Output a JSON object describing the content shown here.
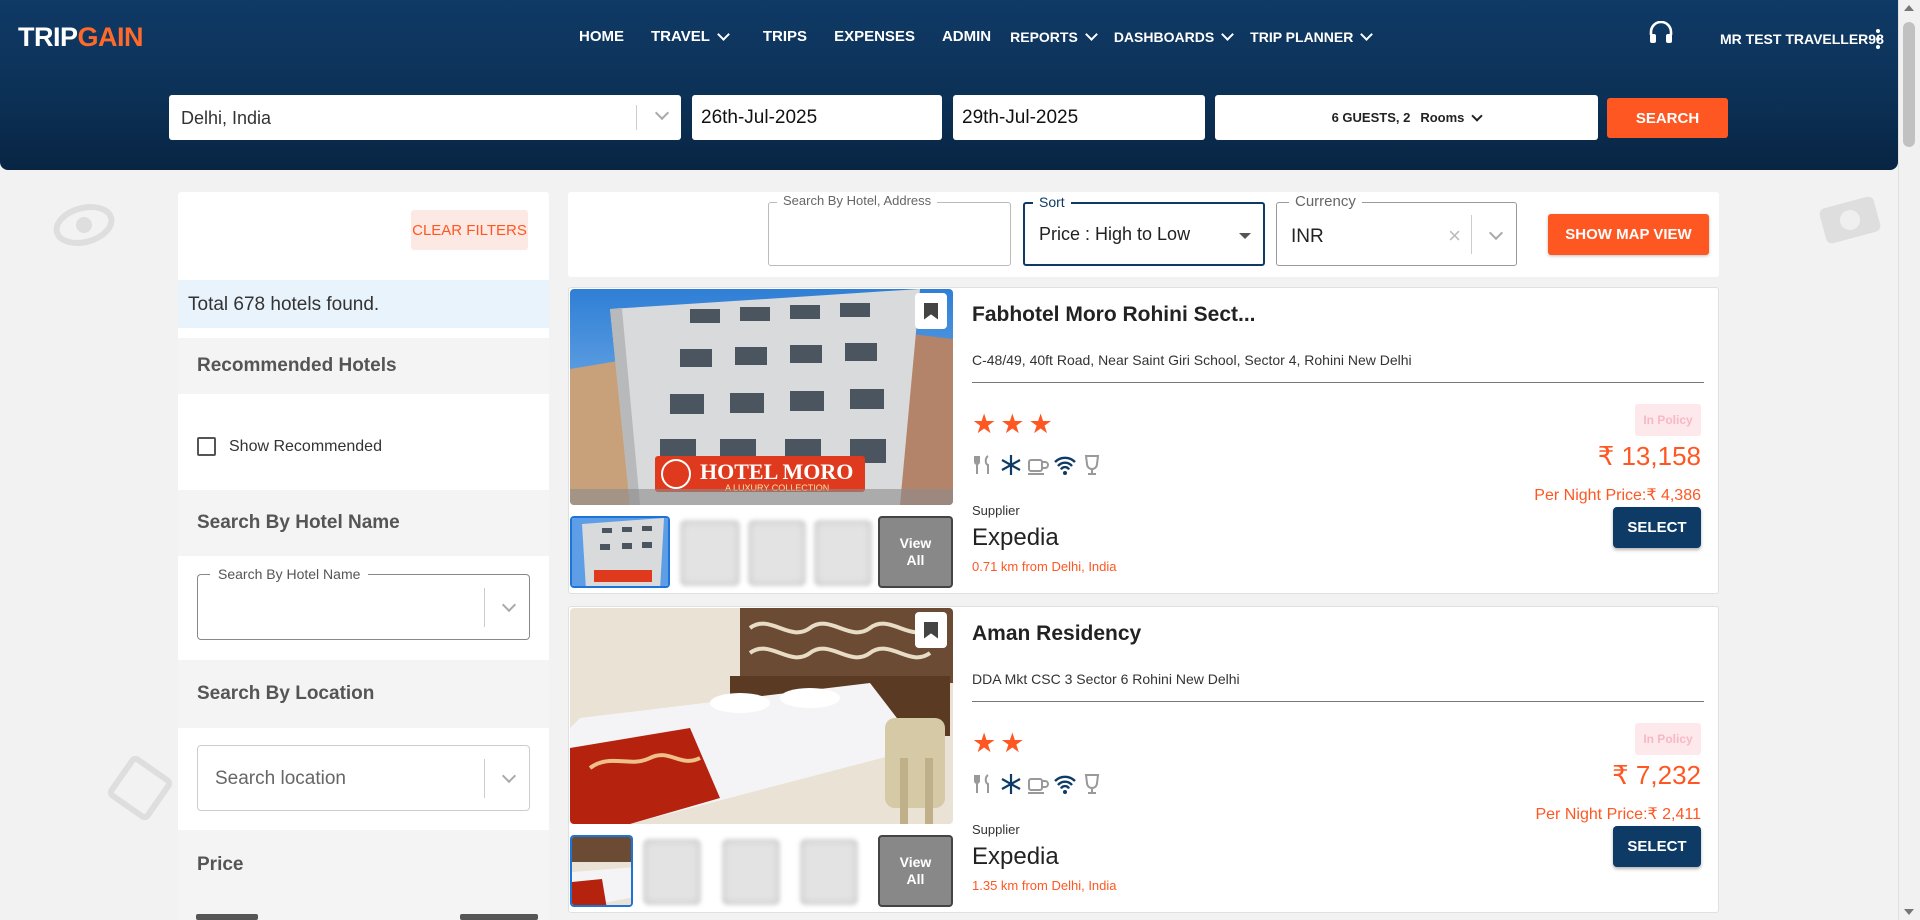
{
  "brand": {
    "logo_part1": "TRIP",
    "logo_part2": "GAIN"
  },
  "nav": {
    "items": [
      {
        "label": "HOME",
        "has_dropdown": false
      },
      {
        "label": "TRAVEL",
        "has_dropdown": true
      },
      {
        "label": "TRIPS",
        "has_dropdown": false
      },
      {
        "label": "EXPENSES",
        "has_dropdown": false
      },
      {
        "label": "ADMIN",
        "has_dropdown": false
      },
      {
        "label": "REPORTS",
        "has_dropdown": true
      },
      {
        "label": "DASHBOARDS",
        "has_dropdown": true
      },
      {
        "label": "TRIP PLANNER",
        "has_dropdown": true
      }
    ],
    "user_name": "MR TEST TRAVELLER98"
  },
  "search": {
    "city": "Delhi, India",
    "check_in": "26th-Jul-2025",
    "check_out": "29th-Jul-2025",
    "guests": "6 GUESTS, 2",
    "rooms_label": "Rooms",
    "search_label": "SEARCH"
  },
  "filters": {
    "clear_label": "CLEAR FILTERS",
    "total_found": "Total 678 hotels found.",
    "recommended_title": "Recommended Hotels",
    "show_recommended_label": "Show Recommended",
    "show_recommended_checked": false,
    "hotel_name_title": "Search By Hotel Name",
    "hotel_name_legend": "Search By Hotel Name",
    "location_title": "Search By Location",
    "location_placeholder": "Search location",
    "price_title": "Price"
  },
  "toolbar": {
    "search_legend": "Search By Hotel, Address",
    "sort_legend": "Sort",
    "sort_value": "Price : High to Low",
    "currency_legend": "Currency",
    "currency_value": "INR",
    "map_label": "SHOW MAP VIEW"
  },
  "hotels": [
    {
      "name": "Fabhotel Moro Rohini Sect...",
      "address": "C-48/49, 40ft Road, Near Saint Giri School, Sector 4, Rohini New Delhi",
      "stars": 3,
      "policy": "In Policy",
      "price": "₹ 13,158",
      "per_night": "Per Night Price:₹ 4,386",
      "supplier_label": "Supplier",
      "supplier": "Expedia",
      "distance": "0.71 km from Delhi, India",
      "select_label": "SELECT",
      "view_all": "View All",
      "photo_sign": "HOTEL MORO",
      "photo_sign_sub": "A LUXURY COLLECTION"
    },
    {
      "name": "Aman Residency",
      "address": "DDA Mkt CSC 3 Sector 6 Rohini New Delhi",
      "stars": 2,
      "policy": "In Policy",
      "price": "₹ 7,232",
      "per_night": "Per Night Price:₹ 2,411",
      "supplier_label": "Supplier",
      "supplier": "Expedia",
      "distance": "1.35 km from Delhi, India",
      "select_label": "SELECT",
      "view_all": "View All"
    }
  ],
  "icons": {
    "amenities": [
      "restaurant-icon",
      "ac-snowflake-icon",
      "coffee-icon",
      "wifi-icon",
      "bar-glass-icon"
    ],
    "support": "headset-icon",
    "bookmark": "bookmark-icon"
  },
  "colors": {
    "accent": "#ff5722",
    "navy": "#0e3a66",
    "header_top": "#0f3a66"
  }
}
